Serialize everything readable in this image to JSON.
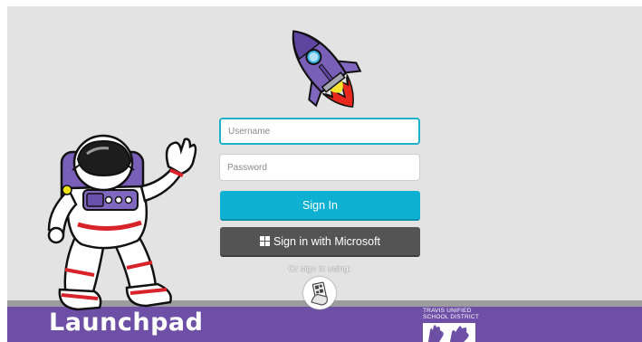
{
  "brand": {
    "name": "Launchpad"
  },
  "district": {
    "line1": "TRAVIS UNIFIED",
    "line2": "SCHOOL DISTRICT"
  },
  "login": {
    "username_placeholder": "Username",
    "password_placeholder": "Password",
    "signin_label": "Sign In",
    "microsoft_label": "Sign in with Microsoft",
    "alt_signin_text": "Or sign in using:"
  },
  "icons": [
    "rocket-icon",
    "astronaut-illustration",
    "windows-icon",
    "qr-badge-icon",
    "district-logo-icon"
  ],
  "colors": {
    "footer": "#6d4fa6",
    "signin_button": "#0fb1d2",
    "microsoft_button": "#545454",
    "input_focus": "#1eb1cc",
    "background": "#e3e3e4"
  }
}
